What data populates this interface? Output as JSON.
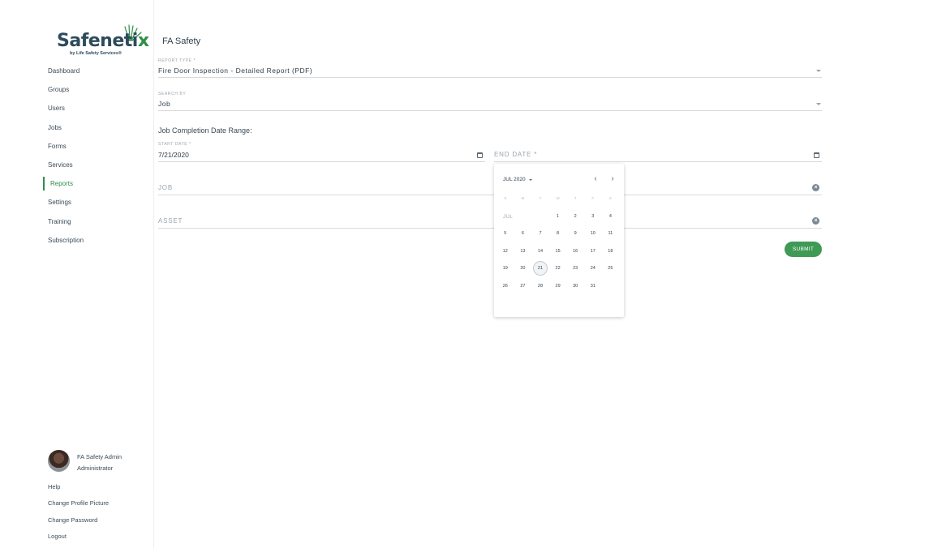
{
  "brand": {
    "name_main": "Safeneti",
    "name_x": "x",
    "tagline": "by Life Safety Services®",
    "accent": "#2e8f47"
  },
  "sidebar": {
    "items": [
      {
        "label": "Dashboard",
        "active": false
      },
      {
        "label": "Groups",
        "active": false
      },
      {
        "label": "Users",
        "active": false
      },
      {
        "label": "Jobs",
        "active": false
      },
      {
        "label": "Forms",
        "active": false
      },
      {
        "label": "Services",
        "active": false
      },
      {
        "label": "Reports",
        "active": true
      },
      {
        "label": "Settings",
        "active": false
      },
      {
        "label": "Training",
        "active": false
      },
      {
        "label": "Subscription",
        "active": false
      }
    ]
  },
  "user": {
    "name": "FA Safety Admin",
    "role": "Administrator"
  },
  "bottom_links": [
    "Help",
    "Change Profile Picture",
    "Change Password",
    "Logout"
  ],
  "main": {
    "title": "FA Safety",
    "report_type": {
      "label": "REPORT TYPE *",
      "value": "Fire Door Inspection - Detailed Report (PDF)"
    },
    "search_by": {
      "label": "SEARCH BY",
      "value": "Job"
    },
    "date_range_label": "Job Completion Date Range:",
    "start_date": {
      "label": "START DATE *",
      "value": "7/21/2020"
    },
    "end_date": {
      "placeholder": "END DATE *"
    },
    "job": {
      "placeholder": "JOB"
    },
    "asset": {
      "placeholder": "ASSET"
    },
    "submit_label": "SUBMIT"
  },
  "calendar": {
    "header": "JUL 2020",
    "month_label": "JUL",
    "weekdays": [
      "S",
      "M",
      "T",
      "W",
      "T",
      "F",
      "S"
    ],
    "weeks": [
      [
        "",
        "",
        "",
        "1",
        "2",
        "3",
        "4"
      ],
      [
        "5",
        "6",
        "7",
        "8",
        "9",
        "10",
        "11"
      ],
      [
        "12",
        "13",
        "14",
        "15",
        "16",
        "17",
        "18"
      ],
      [
        "19",
        "20",
        "21",
        "22",
        "23",
        "24",
        "25"
      ],
      [
        "26",
        "27",
        "28",
        "29",
        "30",
        "31",
        ""
      ]
    ],
    "selected_day": "21"
  }
}
